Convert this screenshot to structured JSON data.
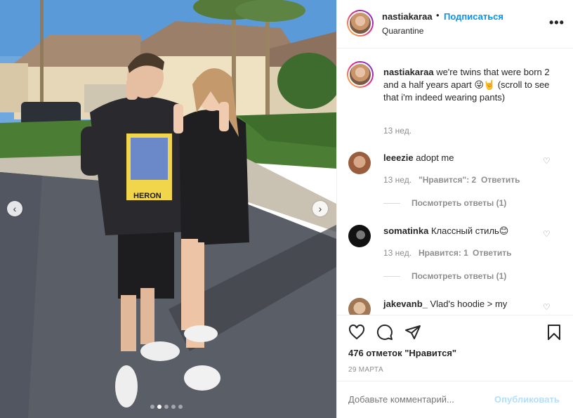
{
  "header": {
    "username": "nastiakaraa",
    "separator": "•",
    "follow_label": "Подписаться",
    "location": "Quarantine",
    "more_label": "•••"
  },
  "caption": {
    "username": "nastiakaraa",
    "text": "we're twins that were born 2 and a half years apart 😜🤘 (scroll to see that i'm indeed wearing pants)",
    "time": "13 нед."
  },
  "comments": [
    {
      "username": "leeezie",
      "text": "adopt me",
      "time": "13 нед.",
      "likes": "\"Нравится\": 2",
      "reply_label": "Ответить",
      "view_replies": "Посмотреть ответы (1)"
    },
    {
      "username": "somatinka",
      "text": "Классный стиль😊",
      "time": "13 нед.",
      "likes": "Нравится: 1",
      "reply_label": "Ответить",
      "view_replies": "Посмотреть ответы (1)"
    },
    {
      "username": "jakevanb_",
      "text": "Vlad's hoodie > my"
    }
  ],
  "actions": {
    "likes_count": "476 отметок \"Нравится\"",
    "date": "29 МАРТА"
  },
  "add_comment": {
    "placeholder": "Добавьте комментарий...",
    "post_label": "Опубликовать"
  },
  "carousel": {
    "current": 2,
    "total": 5,
    "prev_label": "‹",
    "next_label": "›"
  },
  "photo": {
    "hoodie_print_text": "HERON"
  },
  "colors": {
    "link": "#0095f6",
    "muted": "#8e8e8e",
    "text": "#262626",
    "post_disabled": "#b2dffc"
  }
}
